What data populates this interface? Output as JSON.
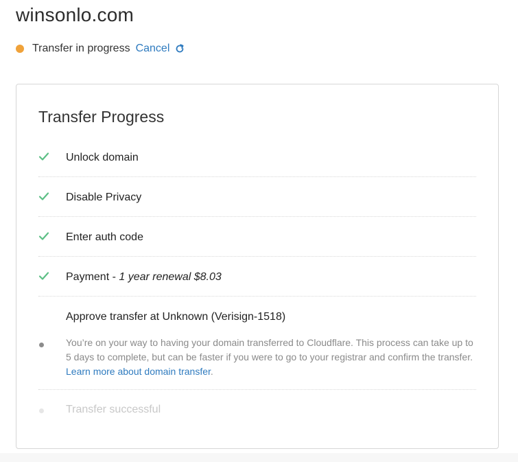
{
  "domain": "winsonlo.com",
  "status": {
    "text": "Transfer in progress",
    "cancel_label": "Cancel",
    "dot_color": "#f0a23a",
    "refresh_icon": "refresh-icon"
  },
  "progress": {
    "title": "Transfer Progress",
    "check_color": "#5cbf85",
    "steps": [
      {
        "label": "Unlock domain",
        "state": "done"
      },
      {
        "label": "Disable Privacy",
        "state": "done"
      },
      {
        "label": "Enter auth code",
        "state": "done"
      },
      {
        "label": "Payment - ",
        "detail": "1 year renewal $8.03",
        "state": "done"
      },
      {
        "label": "Approve transfer at Unknown (Verisign-1518)",
        "state": "current",
        "description": "You’re on your way to having your domain transferred to Cloudflare. This process can take up to 5 days to complete, but can be faster if you were to go to your registrar and confirm the transfer. ",
        "link_text": "Learn more about domain transfer",
        "after_link": "."
      },
      {
        "label": "Transfer successful",
        "state": "pending"
      }
    ]
  }
}
